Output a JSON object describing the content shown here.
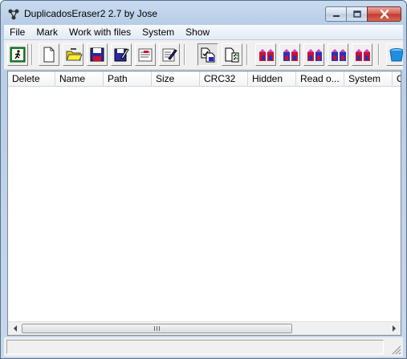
{
  "window": {
    "title": "DuplicadosEraser2 2.7 by Jose"
  },
  "titlebar_buttons": [
    {
      "name": "minimize-button",
      "icon": "minimize-icon"
    },
    {
      "name": "maximize-button",
      "icon": "maximize-icon"
    },
    {
      "name": "close-button",
      "icon": "close-icon"
    }
  ],
  "menu": [
    "File",
    "Mark",
    "Work with files",
    "System",
    "Show"
  ],
  "toolbar": [
    {
      "name": "exit-button",
      "icon": "exit-door-icon"
    },
    {
      "name": "new-button",
      "icon": "new-document-icon"
    },
    {
      "name": "open-button",
      "icon": "open-folder-icon"
    },
    {
      "name": "save-button",
      "icon": "floppy-disk-icon"
    },
    {
      "name": "save-as-button",
      "icon": "floppy-disk-edit-icon"
    },
    {
      "name": "notes-button",
      "icon": "notepad-icon"
    },
    {
      "name": "edit-notes-button",
      "icon": "notepad-pencil-icon"
    },
    {
      "name": "compare-files-button",
      "icon": "compare-files-icon"
    },
    {
      "name": "checklist-button",
      "icon": "checklist-icon"
    },
    {
      "name": "select-1-button",
      "icon": "color-blocks-icon"
    },
    {
      "name": "select-2-button",
      "icon": "color-blocks-icon"
    },
    {
      "name": "select-3-button",
      "icon": "color-blocks-icon"
    },
    {
      "name": "select-4-button",
      "icon": "color-blocks-icon"
    },
    {
      "name": "select-5-button",
      "icon": "color-blocks-icon"
    },
    {
      "name": "recycle-bin-button",
      "icon": "trash-can-icon"
    }
  ],
  "columns": [
    "Delete",
    "Name",
    "Path",
    "Size",
    "CRC32",
    "Hidden",
    "Read o...",
    "System",
    "C"
  ],
  "rows": [],
  "colors": {
    "titlebar": "#c4d7ee",
    "close_button": "#c7402f",
    "exit_icon": "#1c8a2c",
    "blocks_red": "#d0102a",
    "blocks_blue": "#2233c0",
    "blocks_magenta": "#d040c0",
    "trash_blue": "#1e8fe0"
  }
}
